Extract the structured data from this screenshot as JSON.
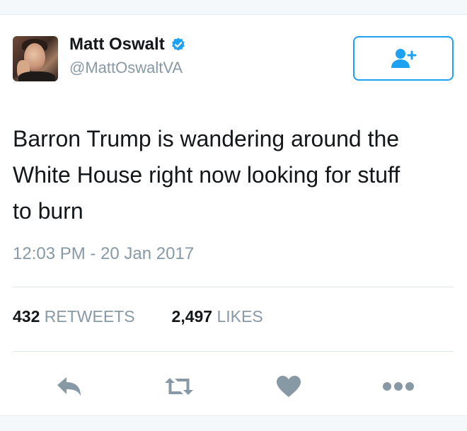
{
  "author": {
    "display_name": "Matt Oswalt",
    "handle": "@MattOswaltVA",
    "verified": true
  },
  "follow_button": {
    "icon": "follow-user-icon"
  },
  "tweet": {
    "text_lines": [
      "Barron Trump is wandering around the",
      "White House right now looking for stuff",
      "to burn"
    ],
    "timestamp": "12:03 PM - 20 Jan 2017"
  },
  "stats": {
    "retweets": {
      "count": "432",
      "label": "RETWEETS"
    },
    "likes": {
      "count": "2,497",
      "label": "LIKES"
    }
  },
  "actions": {
    "reply": "reply-icon",
    "retweet": "retweet-icon",
    "like": "heart-icon",
    "more": "more-icon"
  },
  "colors": {
    "brand_blue": "#1da1f2",
    "icon_gray": "#8899a6",
    "text": "#14171a",
    "muted": "#8899a6"
  }
}
